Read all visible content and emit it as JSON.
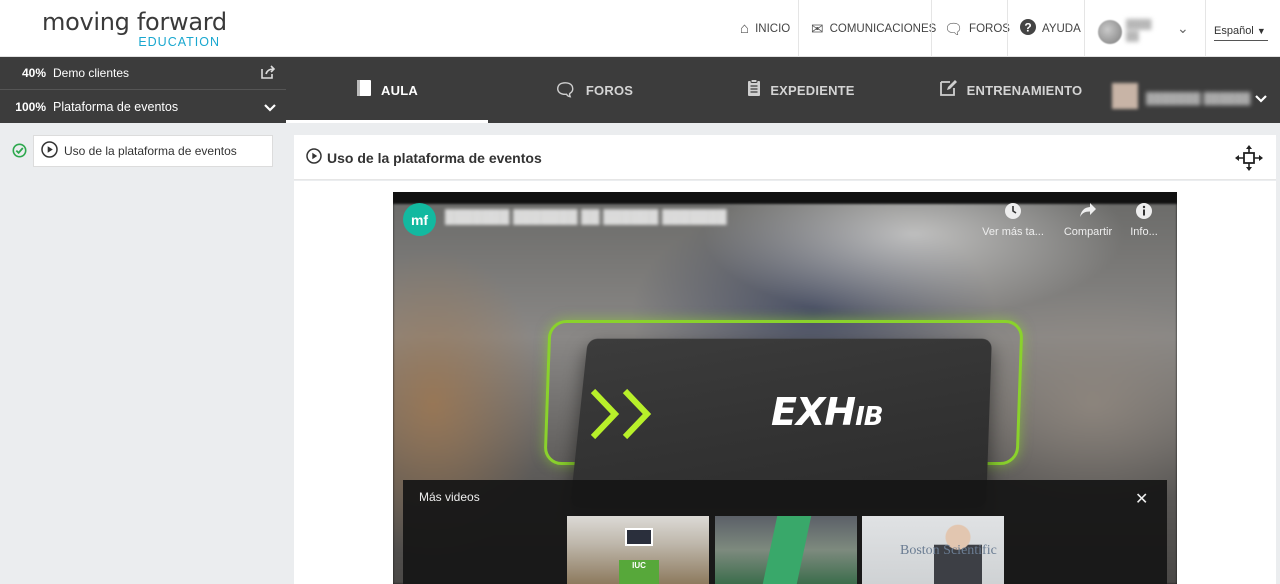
{
  "header": {
    "logo": {
      "main": "moving forward",
      "sub": "EDUCATION"
    },
    "nav": [
      {
        "label": "INICIO",
        "icon": "home-icon"
      },
      {
        "label": "COMUNICACIONES",
        "icon": "envelope-icon"
      },
      {
        "label": "FOROS",
        "icon": "comments-icon"
      },
      {
        "label": "AYUDA",
        "icon": "question-circle-icon"
      }
    ],
    "language": "Español"
  },
  "progress": [
    {
      "percent": "40%",
      "label": "Demo clientes"
    },
    {
      "percent": "100%",
      "label": "Plataforma de eventos"
    }
  ],
  "tabs": [
    {
      "label": "AULA",
      "icon": "book-icon",
      "active": true
    },
    {
      "label": "FOROS",
      "icon": "comments-icon",
      "active": false
    },
    {
      "label": "EXPEDIENTE",
      "icon": "clipboard-icon",
      "active": false
    },
    {
      "label": "ENTRENAMIENTO",
      "icon": "edit-icon",
      "active": false
    }
  ],
  "lessons": [
    {
      "label": "Uso de la plataforma de eventos",
      "completed": true
    }
  ],
  "content": {
    "title": "Uso de la plataforma de eventos"
  },
  "video": {
    "channel_logo": "mf",
    "actions": [
      {
        "label": "Ver más ta...",
        "icon": "clock-icon"
      },
      {
        "label": "Compartir",
        "icon": "share-icon"
      },
      {
        "label": "Info...",
        "icon": "info-icon"
      }
    ],
    "brand_text": "EXH",
    "brand_text_small": "IB",
    "more_videos": {
      "title": "Más videos",
      "thumbnails": [
        {
          "text": "IUC"
        },
        {
          "text": ""
        },
        {
          "text": "Boston Scientific"
        }
      ]
    }
  },
  "colors": {
    "dark_bar": "#3c3c3c",
    "accent_blue": "#19a7cf",
    "neon_green": "#8ad22c",
    "check_green": "#2ca84d"
  }
}
